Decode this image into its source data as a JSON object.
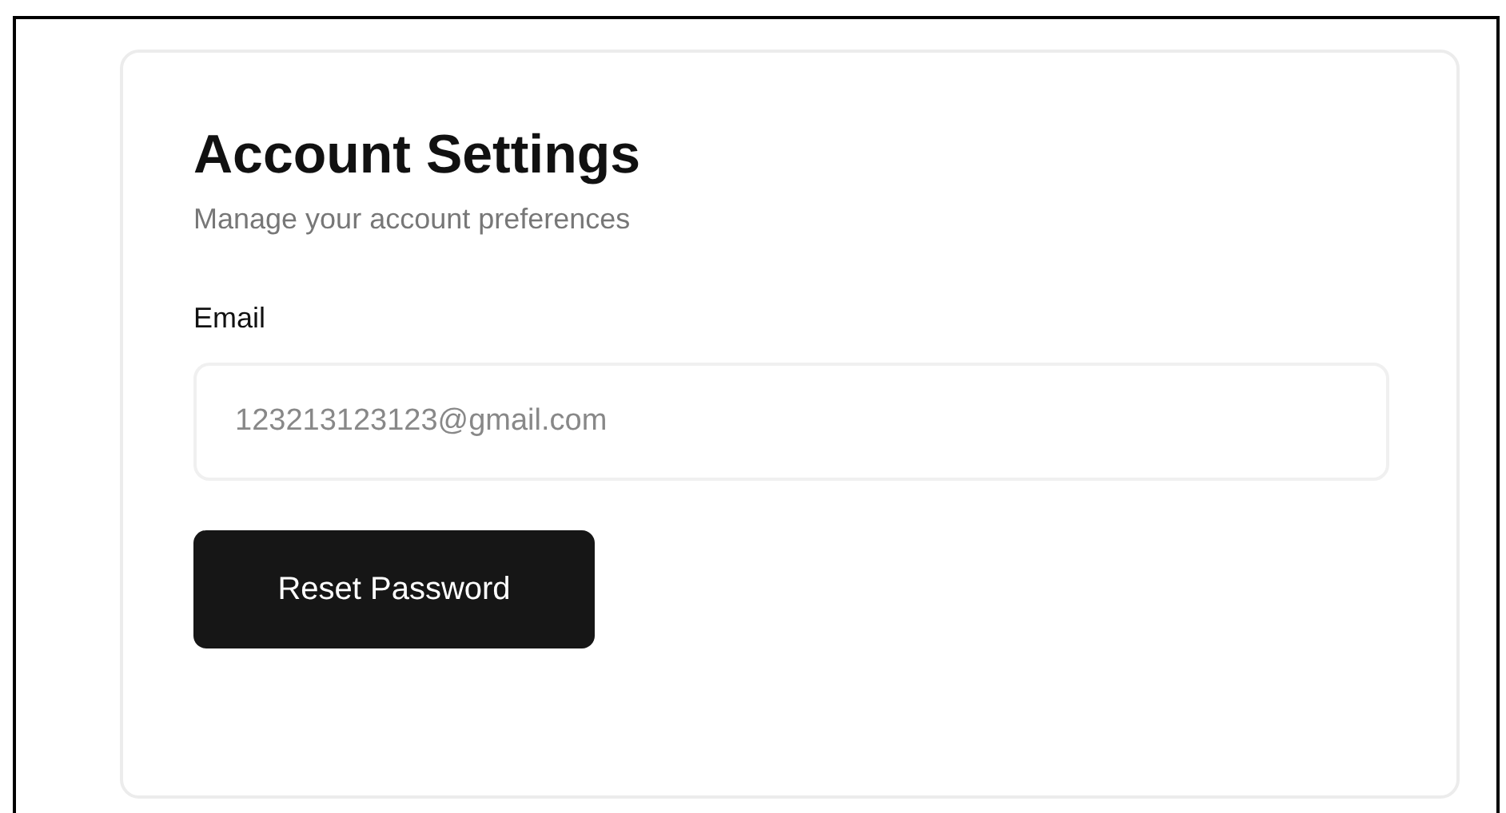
{
  "card": {
    "title": "Account Settings",
    "subtitle": "Manage your account preferences",
    "email": {
      "label": "Email",
      "value": "123213123123@gmail.com"
    },
    "button": "Reset Password"
  }
}
